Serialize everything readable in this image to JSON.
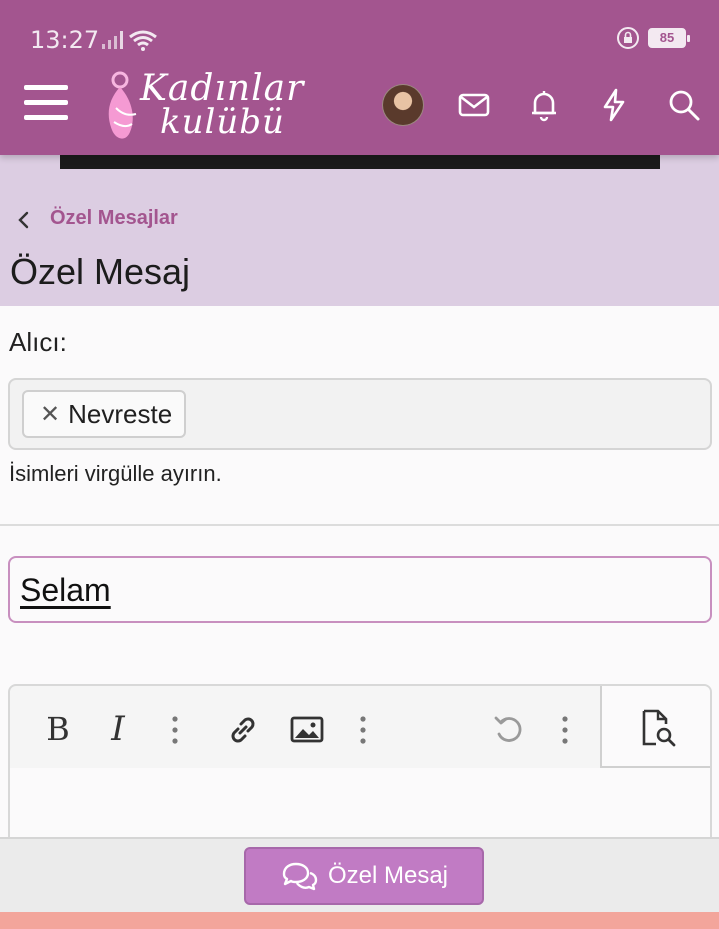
{
  "status_bar": {
    "time": "13:27",
    "battery": "85"
  },
  "header": {
    "logo_line1": "Kadınlar",
    "logo_line2": "kulübü",
    "icons": [
      "menu-icon",
      "avatar",
      "mail-icon",
      "bell-icon",
      "lightning-icon",
      "search-icon"
    ]
  },
  "breadcrumb": {
    "link": "Özel Mesajlar"
  },
  "page": {
    "title": "Özel Mesaj"
  },
  "form": {
    "recipient_label": "Alıcı:",
    "recipients": [
      "Nevreste"
    ],
    "recipient_remove": "✕",
    "hint": "İsimleri virgülle ayırın.",
    "subject_value": "Selam"
  },
  "editor": {
    "toolbar": {
      "bold": "B",
      "italic": "I"
    }
  },
  "footer": {
    "submit_label": "Özel Mesaj"
  },
  "colors": {
    "brand": "#a3558f",
    "breadcrumb_bg": "#dccde2",
    "button": "#c17bc4",
    "subject_border": "#c88fbf"
  }
}
